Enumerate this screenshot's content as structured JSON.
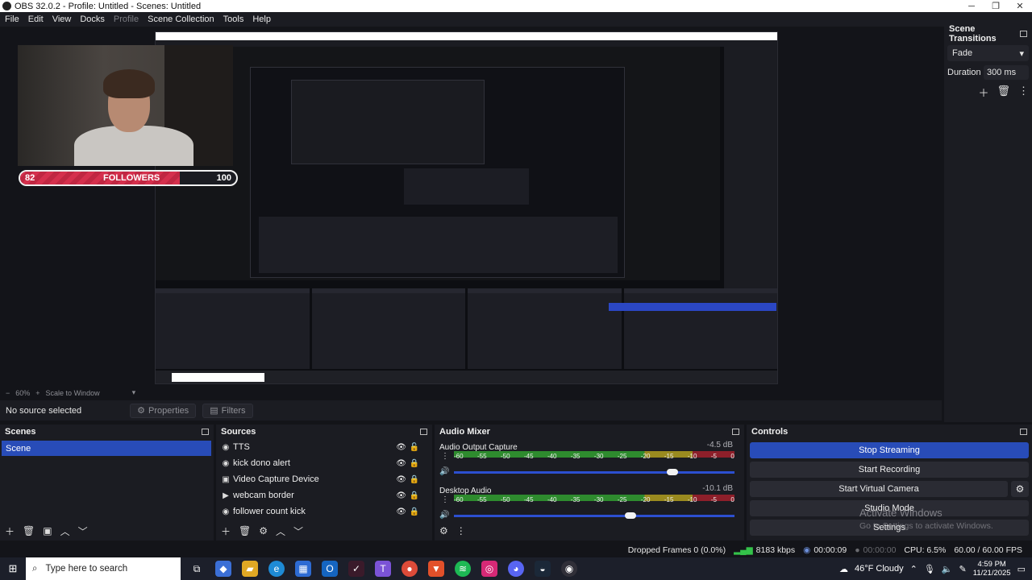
{
  "window": {
    "title": "OBS 32.0.2 - Profile: Untitled - Scenes: Untitled",
    "controls": [
      "─",
      "❐",
      "✕"
    ]
  },
  "menu": [
    "File",
    "Edit",
    "View",
    "Docks",
    "Profile",
    "Scene Collection",
    "Tools",
    "Help"
  ],
  "preview": {
    "followers": {
      "left": "82",
      "label": "FOLLOWERS",
      "right": "100",
      "progress": 0.82
    },
    "zoom_minus": "−",
    "zoom": "60%",
    "zoom_plus": "+",
    "scale_mode": "Scale to Window",
    "scale_caret": "▾"
  },
  "source_bar": {
    "no_source": "No source selected",
    "properties": "Properties",
    "filters": "Filters"
  },
  "scene_transitions": {
    "title": "Scene Transitions",
    "transition": "Fade",
    "duration_label": "Duration",
    "duration_value": "300 ms"
  },
  "scenes": {
    "title": "Scenes",
    "items": [
      "Scene"
    ]
  },
  "sources": {
    "title": "Sources",
    "items": [
      {
        "name": "TTS",
        "icon": "audio-icon"
      },
      {
        "name": "kick dono alert",
        "icon": "browser-icon"
      },
      {
        "name": "Video Capture Device",
        "icon": "camera-icon"
      },
      {
        "name": "webcam border",
        "icon": "media-icon"
      },
      {
        "name": "follower count kick",
        "icon": "browser-icon"
      }
    ]
  },
  "mixer": {
    "title": "Audio Mixer",
    "scale": [
      "-60",
      "-55",
      "-50",
      "-45",
      "-40",
      "-35",
      "-30",
      "-25",
      "-20",
      "-15",
      "-10",
      "-5",
      "0"
    ],
    "channels": [
      {
        "name": "Audio Output Capture",
        "db": "-4.5 dB",
        "volume": 0.78
      },
      {
        "name": "Desktop Audio",
        "db": "-10.1 dB",
        "volume": 0.63
      }
    ]
  },
  "controls": {
    "title": "Controls",
    "stop_streaming": "Stop Streaming",
    "start_recording": "Start Recording",
    "start_virtual_camera": "Start Virtual Camera",
    "studio_mode": "Studio Mode",
    "settings": "Settings",
    "watermark_title": "Activate Windows",
    "watermark_sub": "Go to Settings to activate Windows."
  },
  "status": {
    "dropped": "Dropped Frames 0 (0.0%)",
    "bitrate": "8183 kbps",
    "stream_time": "00:00:09",
    "rec_time": "00:00:00",
    "cpu": "CPU: 6.5%",
    "fps": "60.00 / 60.00 FPS"
  },
  "taskbar": {
    "search_placeholder": "Type here to search",
    "weather": "46°F  Cloudy",
    "time": "4:59 PM",
    "date": "11/21/2025"
  },
  "colors": {
    "accent": "#284cb8",
    "dock_bg": "#1b1c22",
    "app_bg": "#131419",
    "follower_bar": "#d5304d"
  }
}
